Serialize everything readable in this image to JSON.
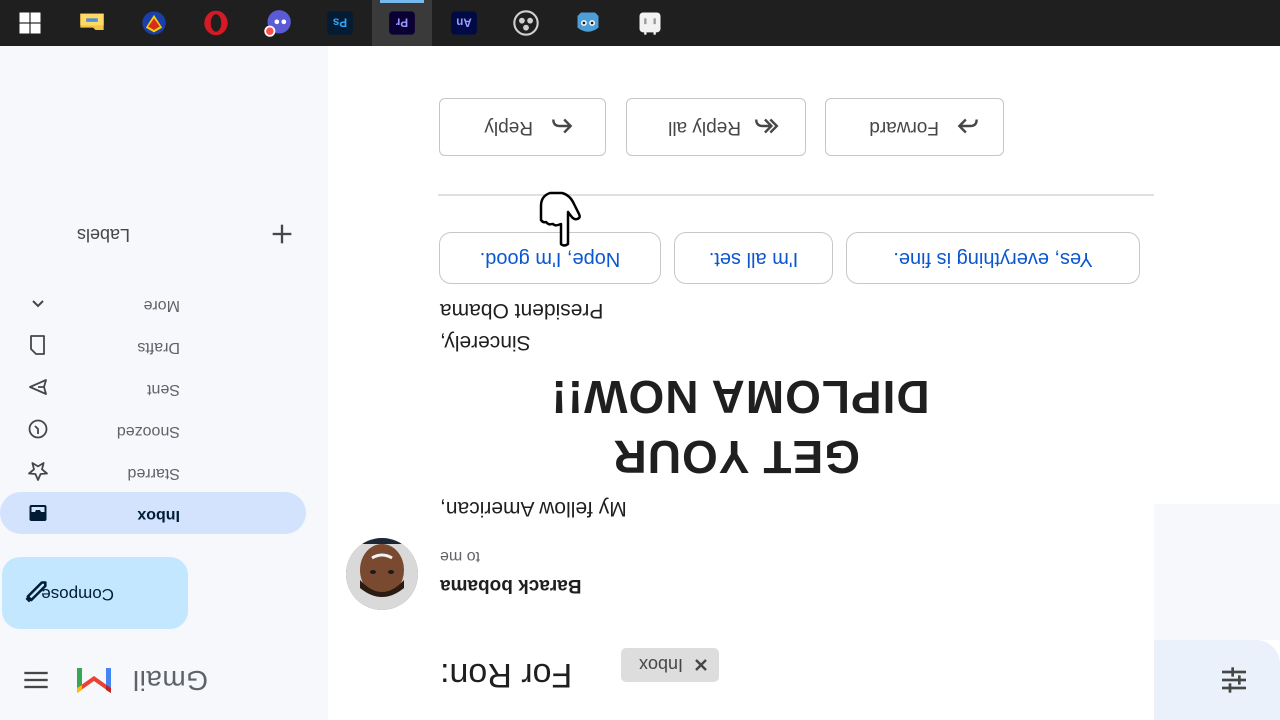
{
  "gmail": {
    "wordmark": "Gmail",
    "brand_colors": {
      "red": "#ea4335",
      "blue": "#4285f4",
      "green": "#34a853",
      "yellow": "#fbbc04"
    }
  },
  "search": {
    "options_icon": "tune-icon"
  },
  "sidebar": {
    "compose_label": "Compose",
    "items": [
      {
        "label": "Inbox",
        "icon": "inbox-icon",
        "active": true
      },
      {
        "label": "Starred",
        "icon": "star-icon",
        "active": false
      },
      {
        "label": "Snoozed",
        "icon": "clock-icon",
        "active": false
      },
      {
        "label": "Sent",
        "icon": "send-icon",
        "active": false
      },
      {
        "label": "Drafts",
        "icon": "draft-icon",
        "active": false
      },
      {
        "label": "More",
        "icon": "chevron-up-icon",
        "active": false
      }
    ],
    "labels_title": "Labels",
    "labels_add_icon": "plus-icon"
  },
  "email": {
    "subject": "For Ron:",
    "chip_label": "Inbox",
    "sender_name": "Barack bobama",
    "recipient": "to me",
    "greeting": "My fellow American,",
    "headline_1": "GET YOUR",
    "headline_2": "DIPLOMA NOW!!",
    "closing": "Sincerely,",
    "signature": "President Obama"
  },
  "smart_replies": [
    "Yes, everything is fine.",
    "I'm all set.",
    "Nope, I'm good."
  ],
  "actions": [
    {
      "label": "Reply",
      "icon": "reply-icon"
    },
    {
      "label": "Reply all",
      "icon": "reply-all-icon"
    },
    {
      "label": "Forward",
      "icon": "forward-icon"
    }
  ],
  "taskbar": {
    "apps": [
      {
        "name": "windows-start-icon",
        "active": false
      },
      {
        "name": "file-explorer-icon",
        "active": false
      },
      {
        "name": "superman-icon",
        "active": false
      },
      {
        "name": "opera-icon",
        "active": false
      },
      {
        "name": "bubble-app-icon",
        "active": false
      },
      {
        "name": "photoshop-icon",
        "label": "Ps",
        "active": false
      },
      {
        "name": "premiere-icon",
        "label": "Pr",
        "active": true
      },
      {
        "name": "animate-icon",
        "label": "An",
        "active": false
      },
      {
        "name": "davinci-icon",
        "active": false
      },
      {
        "name": "robot-app-icon",
        "active": false
      },
      {
        "name": "white-app-icon",
        "active": false
      }
    ]
  }
}
